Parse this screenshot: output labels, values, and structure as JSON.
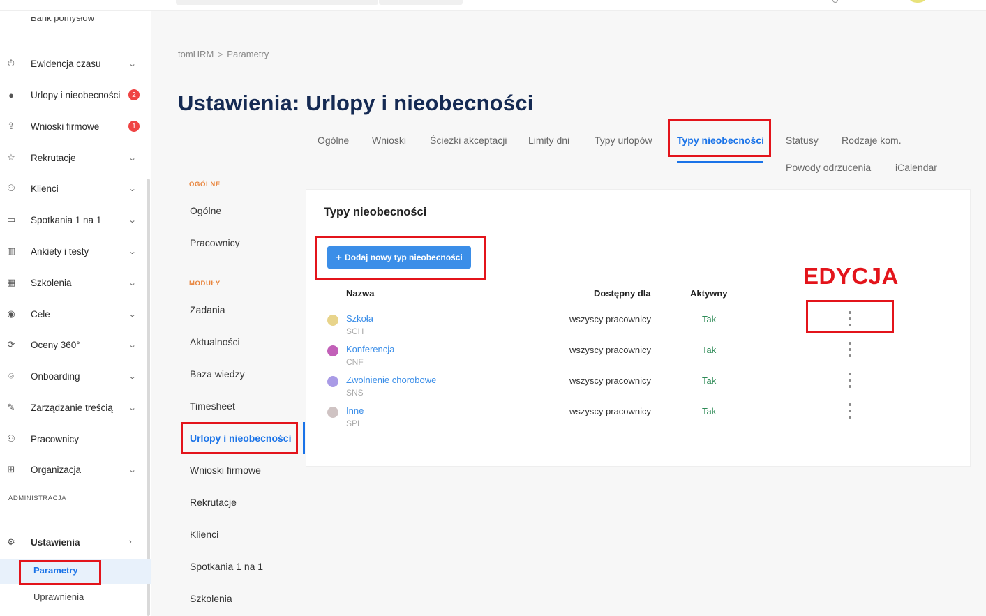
{
  "breadcrumb": {
    "root": "tomHRM",
    "separator": ">",
    "current": "Parametry"
  },
  "page": {
    "title": "Ustawienia: Urlopy i nieobecności"
  },
  "sidebar": {
    "cut_item": "Bank pomysłów",
    "items": [
      {
        "label": "Ewidencja czasu",
        "icon": "stopwatch-icon"
      },
      {
        "label": "Urlopy i nieobecności",
        "icon": "pin-icon",
        "badge": "2"
      },
      {
        "label": "Wnioski firmowe",
        "icon": "inbox-icon",
        "badge": "1"
      },
      {
        "label": "Rekrutacje",
        "icon": "star-icon"
      },
      {
        "label": "Klienci",
        "icon": "users-group-icon"
      },
      {
        "label": "Spotkania 1 na 1",
        "icon": "chat-icon"
      },
      {
        "label": "Ankiety i testy",
        "icon": "chart-icon"
      },
      {
        "label": "Szkolenia",
        "icon": "training-icon"
      },
      {
        "label": "Cele",
        "icon": "target-icon"
      },
      {
        "label": "Oceny 360°",
        "icon": "rotate-icon"
      },
      {
        "label": "Onboarding",
        "icon": "location-icon"
      },
      {
        "label": "Zarządzanie treścią",
        "icon": "pen-icon"
      },
      {
        "label": "Pracownicy",
        "icon": "people-icon"
      },
      {
        "label": "Organizacja",
        "icon": "org-chart-icon"
      }
    ],
    "section_admin": "ADMINISTRACJA",
    "settings_label": "Ustawienia",
    "sub_items": [
      "Parametry",
      "Uprawnienia"
    ]
  },
  "tabs": [
    "Ogólne",
    "Wnioski",
    "Ścieżki akceptacji",
    "Limity dni",
    "Typy urlopów",
    "Typy nieobecności",
    "Statusy",
    "Rodzaje kom.",
    "Powody odrzucenia",
    "iCalendar"
  ],
  "secondary_nav": {
    "section_general": "OGÓLNE",
    "general_items": [
      "Ogólne",
      "Pracownicy"
    ],
    "section_modules": "MODUŁY",
    "module_items": [
      "Zadania",
      "Aktualności",
      "Baza wiedzy",
      "Timesheet",
      "Urlopy i nieobecności",
      "Wnioski firmowe",
      "Rekrutacje",
      "Klienci",
      "Spotkania 1 na 1",
      "Szkolenia"
    ]
  },
  "card": {
    "title": "Typy nieobecności",
    "add_button": "Dodaj nowy typ nieobecności",
    "columns": {
      "name": "Nazwa",
      "available": "Dostępny dla",
      "active": "Aktywny"
    },
    "rows": [
      {
        "name": "Szkoła",
        "code": "SCH",
        "available": "wszyscy pracownicy",
        "active": "Tak",
        "color": "#e8d48b"
      },
      {
        "name": "Konferencja",
        "code": "CNF",
        "available": "wszyscy pracownicy",
        "active": "Tak",
        "color": "#c260b8"
      },
      {
        "name": "Zwolnienie chorobowe",
        "code": "SNS",
        "available": "wszyscy pracownicy",
        "active": "Tak",
        "color": "#a99be6"
      },
      {
        "name": "Inne",
        "code": "SPL",
        "available": "wszyscy pracownicy",
        "active": "Tak",
        "color": "#cfc3c3"
      }
    ]
  },
  "annotation": {
    "label": "EDYCJA"
  },
  "colors": {
    "accent": "#1a73e8",
    "title": "#152a53",
    "annotation": "#e3141b",
    "active_yes": "#2e8b57"
  }
}
